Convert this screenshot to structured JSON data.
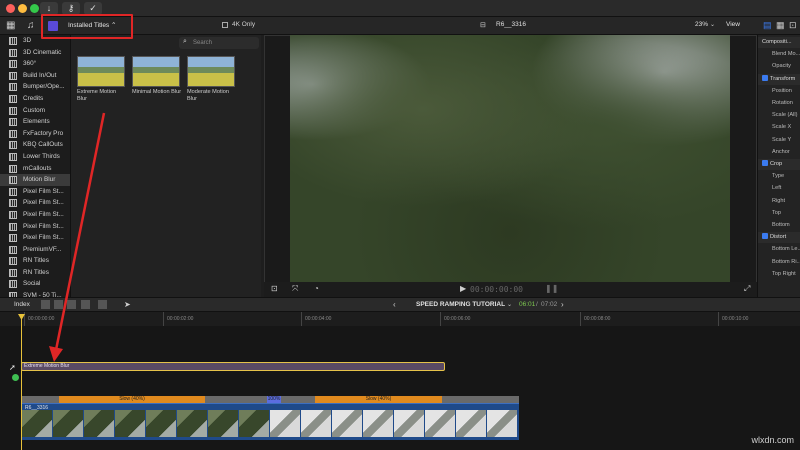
{
  "toolbar": {
    "installed_titles_label": "Installed Titles",
    "four_k_label": "4K Only",
    "search_placeholder": "Search",
    "clip_name": "R6__3316",
    "zoom": "23%",
    "view_label": "View"
  },
  "sidebar": {
    "items": [
      {
        "label": "3D",
        "selected": false
      },
      {
        "label": "3D Cinematic",
        "selected": false
      },
      {
        "label": "360°",
        "selected": false
      },
      {
        "label": "Build In/Out",
        "selected": false
      },
      {
        "label": "Bumper/Ope...",
        "selected": false
      },
      {
        "label": "Credits",
        "selected": false
      },
      {
        "label": "Custom",
        "selected": false
      },
      {
        "label": "Elements",
        "selected": false
      },
      {
        "label": "FxFactory Pro",
        "selected": false
      },
      {
        "label": "KBQ CallOuts",
        "selected": false
      },
      {
        "label": "Lower Thirds",
        "selected": false
      },
      {
        "label": "mCallouts",
        "selected": false
      },
      {
        "label": "Motion Blur",
        "selected": true
      },
      {
        "label": "Pixel Film St...",
        "selected": false
      },
      {
        "label": "Pixel Film St...",
        "selected": false
      },
      {
        "label": "Pixel Film St...",
        "selected": false
      },
      {
        "label": "Pixel Film St...",
        "selected": false
      },
      {
        "label": "Pixel Film St...",
        "selected": false
      },
      {
        "label": "PremiumVF...",
        "selected": false
      },
      {
        "label": "RN Titles",
        "selected": false
      },
      {
        "label": "RN Titles",
        "selected": false
      },
      {
        "label": "Social",
        "selected": false
      },
      {
        "label": "SVM - 50 Ti...",
        "selected": false
      }
    ]
  },
  "browser": {
    "thumbnails": [
      {
        "label": "Extreme Motion Blur"
      },
      {
        "label": "Minimal Motion Blur"
      },
      {
        "label": "Moderate Motion Blur"
      }
    ]
  },
  "viewer": {
    "timecode": "00:00:00:00"
  },
  "inspector": {
    "rows": [
      {
        "label": "Compositi...",
        "type": "head"
      },
      {
        "label": "Blend Mo...",
        "type": "row"
      },
      {
        "label": "Opacity",
        "type": "row"
      },
      {
        "label": "Transform",
        "type": "check"
      },
      {
        "label": "Position",
        "type": "row"
      },
      {
        "label": "Rotation",
        "type": "row"
      },
      {
        "label": "Scale (All)",
        "type": "row"
      },
      {
        "label": "Scale X",
        "type": "row"
      },
      {
        "label": "Scale Y",
        "type": "row"
      },
      {
        "label": "Anchor",
        "type": "row"
      },
      {
        "label": "Crop",
        "type": "check"
      },
      {
        "label": "Type",
        "type": "row"
      },
      {
        "label": "Left",
        "type": "row"
      },
      {
        "label": "Right",
        "type": "row"
      },
      {
        "label": "Top",
        "type": "row"
      },
      {
        "label": "Bottom",
        "type": "row"
      },
      {
        "label": "Distort",
        "type": "check"
      },
      {
        "label": "Bottom Le...",
        "type": "row"
      },
      {
        "label": "Bottom Ri...",
        "type": "row"
      },
      {
        "label": "Top Right",
        "type": "row"
      }
    ]
  },
  "timeline": {
    "index_label": "Index",
    "project_name": "SPEED RAMPING TUTORIAL",
    "duration_current": "06:01",
    "duration_total": "07:02",
    "ruler_ticks": [
      "00:00:00:00",
      "00:00:02:00",
      "00:00:04:00",
      "00:00:06:00",
      "00:00:08:00",
      "00:00:10:00"
    ],
    "title_clip_label": "Extreme Motion Blur",
    "clip_label": "R6__3316",
    "speed_segments": [
      {
        "label": "Slow (40%)",
        "color": "#e08a1e"
      },
      {
        "label": "100%",
        "color": "#5b6de0"
      },
      {
        "label": "Slow (40%)",
        "color": "#e08a1e"
      }
    ]
  },
  "watermark": "wlxdn.com",
  "colors": {
    "accent": "#e8c23a",
    "annotation": "#e02626",
    "clip_blue": "#1f4a8a"
  }
}
